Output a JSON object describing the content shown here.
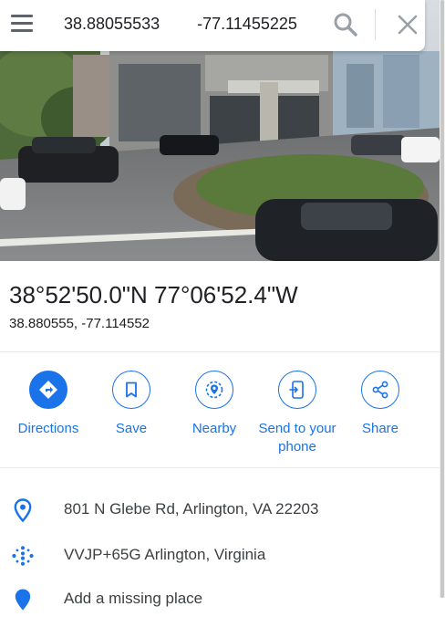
{
  "search": {
    "value": "38.88055533 -77.11455225"
  },
  "place": {
    "title": "38°52'50.0\"N 77°06'52.4\"W",
    "decimal_coords": "38.880555, -77.114552"
  },
  "actions": [
    {
      "label": "Directions",
      "icon": "directions-icon"
    },
    {
      "label": "Save",
      "icon": "bookmark-icon"
    },
    {
      "label": "Nearby",
      "icon": "nearby-icon"
    },
    {
      "label": "Send to your phone",
      "icon": "send-to-phone-icon"
    },
    {
      "label": "Share",
      "icon": "share-icon"
    }
  ],
  "info": {
    "address": "801 N Glebe Rd, Arlington, VA 22203",
    "plus_code": "VVJP+65G Arlington, Virginia",
    "add_place": "Add a missing place"
  },
  "colors": {
    "accent": "#1a73e8",
    "text_primary": "#202124",
    "text_secondary": "#3c4043",
    "icon_gray": "#5f6368"
  }
}
